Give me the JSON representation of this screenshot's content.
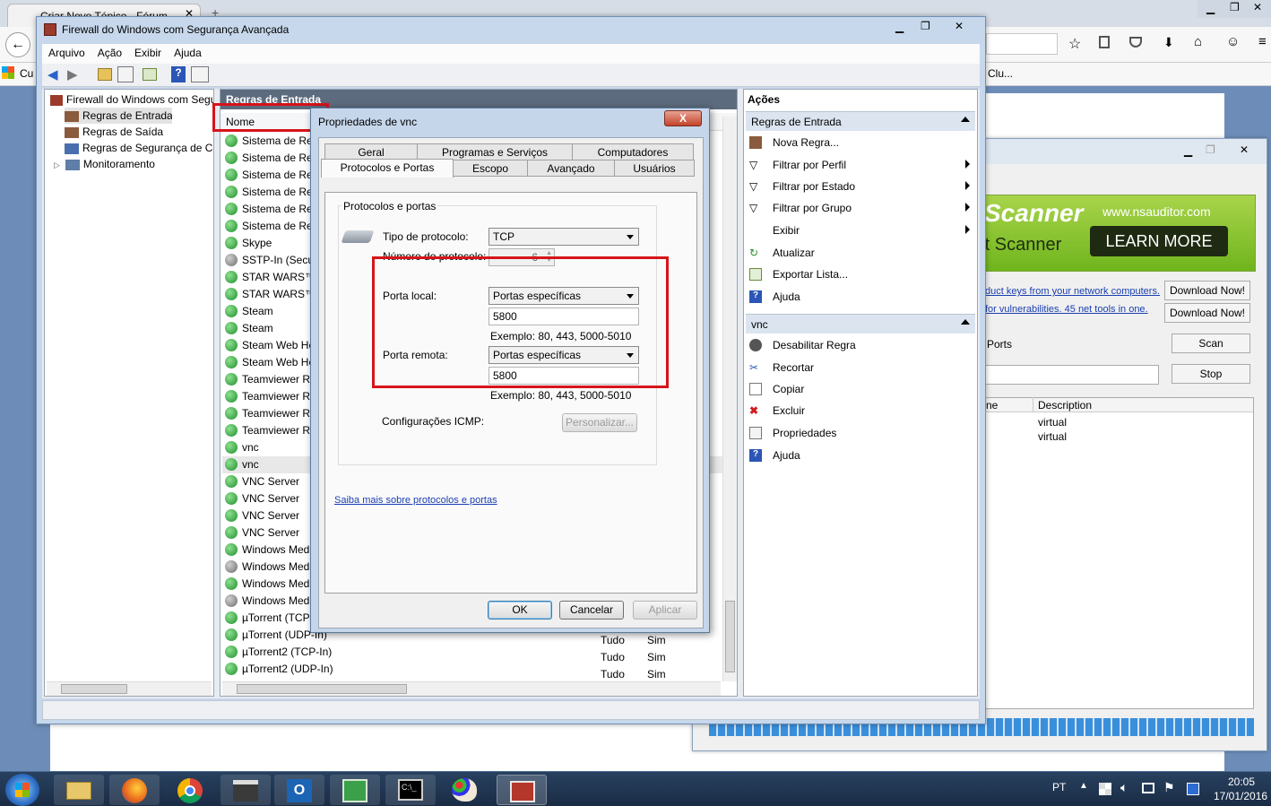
{
  "browser": {
    "tab_title": "Criar Novo Tópico - Fórum...",
    "bookmark_left": "Cu",
    "bookmark_right": "Clu..."
  },
  "nsauditor": {
    "banner_title": "Scanner",
    "banner_sub": "rt Scanner",
    "banner_url": "www.nsauditor.com",
    "learn_more": "LEARN MORE",
    "link1": "duct keys from your network computers.",
    "link2": "for vulnerabilities. 45 net tools in one.",
    "download1": "Download Now!",
    "download2": "Download Now!",
    "ports_label": "Ports",
    "scan": "Scan",
    "stop": "Stop",
    "col_ne": "ne",
    "col_desc": "Description",
    "rows": [
      "virtual",
      "virtual"
    ]
  },
  "firewall": {
    "title": "Firewall do Windows com Segurança Avançada",
    "menu": [
      "Arquivo",
      "Ação",
      "Exibir",
      "Ajuda"
    ],
    "tree": {
      "root": "Firewall do Windows com Segurança Avançada",
      "inbound": "Regras de Entrada",
      "outbound": "Regras de Saída",
      "security": "Regras de Segurança de Conexão",
      "monitor": "Monitoramento"
    },
    "center_title": "Regras de Entrada",
    "col_name": "Nome",
    "rules": [
      {
        "name": "Sistema de Rede",
        "enabled": true
      },
      {
        "name": "Sistema de Rede",
        "enabled": true
      },
      {
        "name": "Sistema de Rede",
        "enabled": true
      },
      {
        "name": "Sistema de Rede",
        "enabled": true
      },
      {
        "name": "Sistema de Rede",
        "enabled": true
      },
      {
        "name": "Sistema de Rede",
        "enabled": true
      },
      {
        "name": "Skype",
        "enabled": true
      },
      {
        "name": "SSTP-In (Secure",
        "enabled": false
      },
      {
        "name": "STAR WARS™ B",
        "enabled": true
      },
      {
        "name": "STAR WARS™ B",
        "enabled": true
      },
      {
        "name": "Steam",
        "enabled": true
      },
      {
        "name": "Steam",
        "enabled": true
      },
      {
        "name": "Steam Web Help",
        "enabled": true
      },
      {
        "name": "Steam Web Help",
        "enabled": true
      },
      {
        "name": "Teamviewer Rem",
        "enabled": true
      },
      {
        "name": "Teamviewer Rem",
        "enabled": true
      },
      {
        "name": "Teamviewer Rem",
        "enabled": true
      },
      {
        "name": "Teamviewer Rem",
        "enabled": true
      },
      {
        "name": "vnc",
        "enabled": true
      },
      {
        "name": "vnc",
        "enabled": true
      },
      {
        "name": "VNC Server",
        "enabled": true
      },
      {
        "name": "VNC Server",
        "enabled": true
      },
      {
        "name": "VNC Server",
        "enabled": true
      },
      {
        "name": "VNC Server",
        "enabled": true
      },
      {
        "name": "Windows Media",
        "enabled": true
      },
      {
        "name": "Windows Media",
        "enabled": false
      },
      {
        "name": "Windows Media",
        "enabled": true
      },
      {
        "name": "Windows Media",
        "enabled": false
      },
      {
        "name": "µTorrent (TCP-In)",
        "enabled": true
      },
      {
        "name": "µTorrent (UDP-In)",
        "enabled": true
      },
      {
        "name": "µTorrent2 (TCP-In)",
        "enabled": true
      },
      {
        "name": "µTorrent2 (UDP-In)",
        "enabled": true
      }
    ],
    "bottom_rows": [
      {
        "profile": "Tudo",
        "enabled": "Sim"
      },
      {
        "profile": "Tudo",
        "enabled": "Sim"
      },
      {
        "profile": "Tudo",
        "enabled": "Sim"
      }
    ],
    "actions": {
      "title": "Ações",
      "section1": "Regras de Entrada",
      "items1": [
        "Nova Regra...",
        "Filtrar por Perfil",
        "Filtrar por Estado",
        "Filtrar por Grupo",
        "Exibir",
        "Atualizar",
        "Exportar Lista...",
        "Ajuda"
      ],
      "section2": "vnc",
      "items2": [
        "Desabilitar Regra",
        "Recortar",
        "Copiar",
        "Excluir",
        "Propriedades",
        "Ajuda"
      ]
    }
  },
  "dialog": {
    "title": "Propriedades de vnc",
    "close": "X",
    "tabs_row1": [
      "Geral",
      "Programas e Serviços",
      "Computadores"
    ],
    "tabs_row2": [
      "Protocolos e Portas",
      "Escopo",
      "Avançado",
      "Usuários"
    ],
    "group_label": "Protocolos e portas",
    "protocol_type_label": "Tipo de protocolo:",
    "protocol_type_value": "TCP",
    "protocol_number_label": "Número do protocolo:",
    "protocol_number_value": "6",
    "local_port_label": "Porta local:",
    "local_port_mode": "Portas específicas",
    "local_port_value": "5800",
    "local_example": "Exemplo: 80, 443, 5000-5010",
    "remote_port_label": "Porta remota:",
    "remote_port_mode": "Portas específicas",
    "remote_port_value": "5800",
    "remote_example": "Exemplo: 80, 443, 5000-5010",
    "icmp_label": "Configurações ICMP:",
    "customize": "Personalizar...",
    "learn_link": "Saiba mais sobre protocolos e portas",
    "ok": "OK",
    "cancel": "Cancelar",
    "apply": "Aplicar"
  },
  "taskbar": {
    "lang": "PT",
    "time": "20:05",
    "date": "17/01/2016"
  }
}
